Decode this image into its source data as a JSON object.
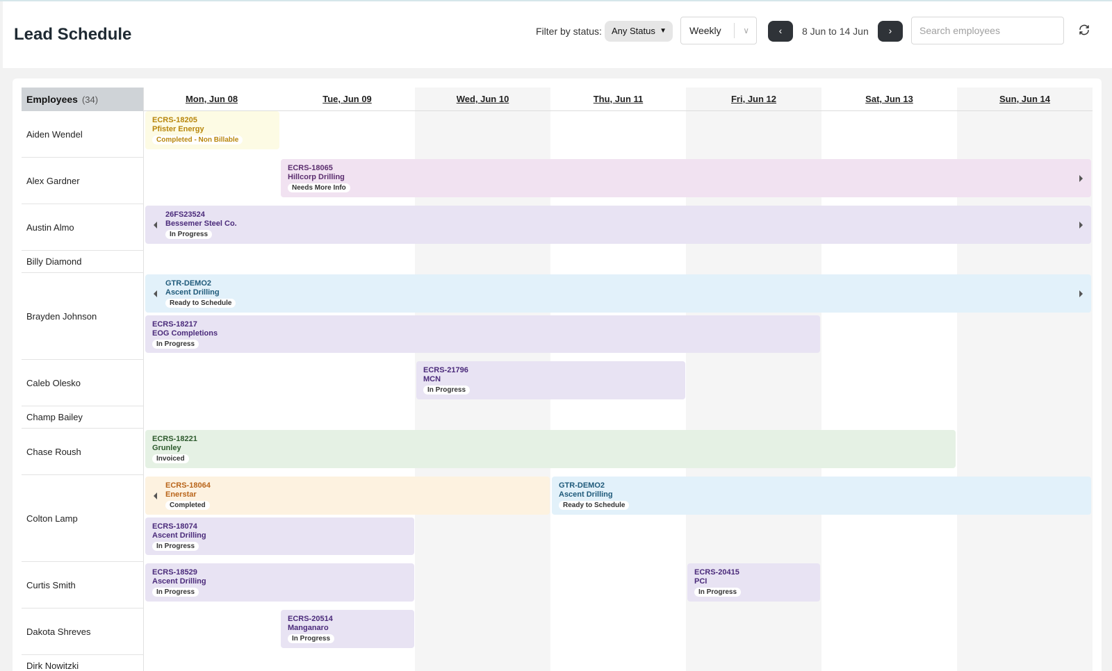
{
  "header": {
    "title": "Lead Schedule",
    "filter_label": "Filter by status:",
    "status_value": "Any Status",
    "view_value": "Weekly",
    "date_range": "8 Jun to 14 Jun",
    "search_placeholder": "Search employees"
  },
  "employees_header": {
    "label": "Employees",
    "count": "(34)"
  },
  "days": [
    "Mon, Jun 08",
    "Tue, Jun 09",
    "Wed, Jun 10",
    "Thu, Jun 11",
    "Fri, Jun 12",
    "Sat, Jun 13",
    "Sun, Jun 14"
  ],
  "employees": [
    "Aiden Wendel",
    "Alex Gardner",
    "Austin Almo",
    "Billy Diamond",
    "Brayden Johnson",
    "Caleb Olesko",
    "Champ Bailey",
    "Chase Roush",
    "Colton Lamp",
    "Curtis Smith",
    "Dakota Shreves",
    "Dirk Nowitzki"
  ],
  "jobs": [
    {
      "id": "ECRS-18205",
      "client": "Pfister Energy",
      "status": "Completed - Non Billable",
      "color": "yellow"
    },
    {
      "id": "ECRS-18065",
      "client": "Hillcorp Drilling",
      "status": "Needs More Info",
      "color": "pink"
    },
    {
      "id": "26FS23524",
      "client": "Bessemer Steel Co.",
      "status": "In Progress",
      "color": "purple"
    },
    {
      "id": "GTR-DEMO2",
      "client": "Ascent Drilling",
      "status": "Ready to Schedule",
      "color": "blue"
    },
    {
      "id": "ECRS-18217",
      "client": "EOG Completions",
      "status": "In Progress",
      "color": "purple"
    },
    {
      "id": "ECRS-21796",
      "client": "MCN",
      "status": "In Progress",
      "color": "purple"
    },
    {
      "id": "ECRS-18221",
      "client": "Grunley",
      "status": "Invoiced",
      "color": "green"
    },
    {
      "id": "ECRS-18064",
      "client": "Enerstar",
      "status": "Completed",
      "color": "orange"
    },
    {
      "id": "GTR-DEMO2",
      "client": "Ascent Drilling",
      "status": "Ready to Schedule",
      "color": "blue"
    },
    {
      "id": "ECRS-18074",
      "client": "Ascent Drilling",
      "status": "In Progress",
      "color": "purple"
    },
    {
      "id": "ECRS-18529",
      "client": "Ascent Drilling",
      "status": "In Progress",
      "color": "purple"
    },
    {
      "id": "ECRS-20415",
      "client": "PCI",
      "status": "In Progress",
      "color": "purple"
    },
    {
      "id": "ECRS-20514",
      "client": "Manganaro",
      "status": "In Progress",
      "color": "purple"
    }
  ],
  "colors": {
    "yellow": "#fdfbe4",
    "pink": "#f1e2f1",
    "purple": "#e8e3f3",
    "blue": "#e2f1fa",
    "green": "#e5f1e4",
    "orange": "#fdf2e0",
    "nav_button": "#2f3338"
  }
}
